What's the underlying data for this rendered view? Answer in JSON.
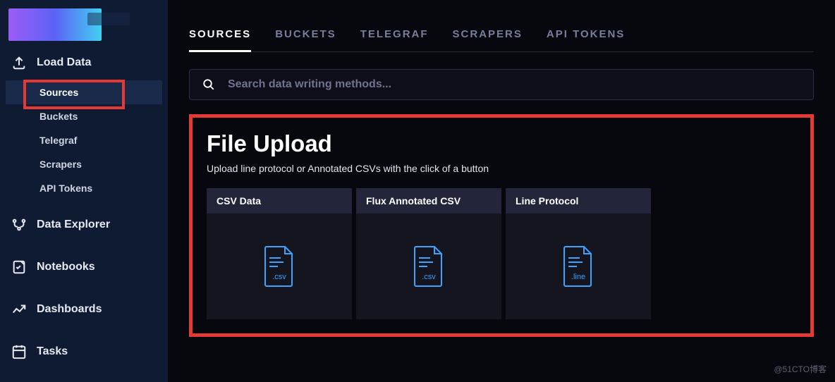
{
  "sidebar": {
    "nav": {
      "load_data": "Load Data",
      "data_explorer": "Data Explorer",
      "notebooks": "Notebooks",
      "dashboards": "Dashboards",
      "tasks": "Tasks"
    },
    "sub": {
      "sources": "Sources",
      "buckets": "Buckets",
      "telegraf": "Telegraf",
      "scrapers": "Scrapers",
      "api_tokens": "API Tokens"
    }
  },
  "tabs": {
    "sources": "SOURCES",
    "buckets": "BUCKETS",
    "telegraf": "TELEGRAF",
    "scrapers": "SCRAPERS",
    "api_tokens": "API TOKENS"
  },
  "search": {
    "placeholder": "Search data writing methods..."
  },
  "panel": {
    "title": "File Upload",
    "subtitle": "Upload line protocol or Annotated CSVs with the click of a button"
  },
  "cards": {
    "csv": {
      "title": "CSV Data",
      "ext": ".csv"
    },
    "flux": {
      "title": "Flux Annotated CSV",
      "ext": ".csv"
    },
    "line": {
      "title": "Line Protocol",
      "ext": ".line"
    }
  },
  "watermark": "@51CTO博客"
}
